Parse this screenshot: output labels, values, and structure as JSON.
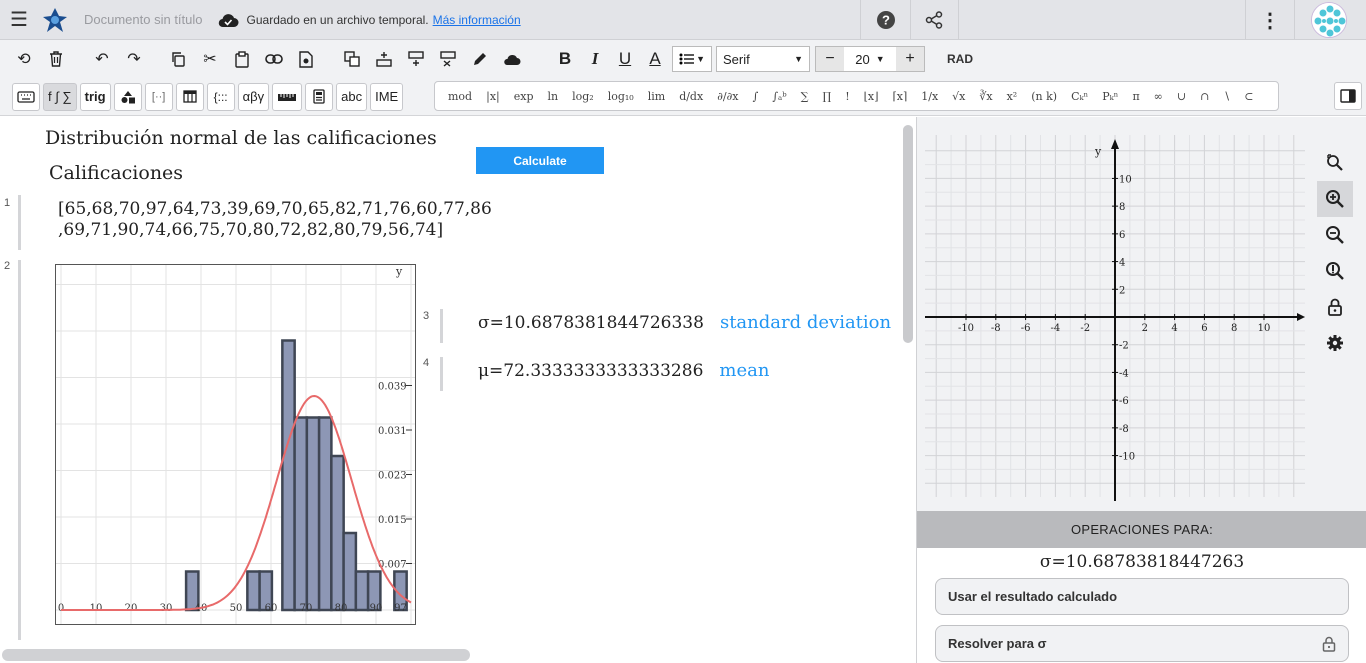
{
  "topbar": {
    "doc_title": "Documento sin título",
    "save_status": "Guardado en un archivo temporal.",
    "more_info_link": "Más información"
  },
  "toolbar": {
    "font_family": "Serif",
    "font_size": "20",
    "angle_mode": "RAD",
    "bold": "B",
    "italic": "I",
    "underline": "U",
    "color": "A",
    "minus": "−",
    "plus": "+"
  },
  "keyboard_tabs": [
    "f ∫ ∑",
    "trig",
    "αβγ",
    "abc",
    "IME"
  ],
  "symbols": [
    "mod",
    "|x|",
    "exp",
    "ln",
    "log₂",
    "log₁₀",
    "lim",
    "d/dx",
    "∂/∂x",
    "∫",
    "∫ₐᵇ",
    "∑",
    "∏",
    "!",
    "⌊x⌋",
    "⌈x⌉",
    "1/x",
    "√x",
    "∛x",
    "x²",
    "(n k)",
    "Cₖⁿ",
    "Pₖⁿ",
    "π",
    "∞",
    "∪",
    "∩",
    "∖",
    "⊂"
  ],
  "doc": {
    "heading": "Distribución normal de las calificaciones",
    "subheading": "Calificaciones",
    "calculate_button": "Calculate",
    "line_numbers": [
      "1",
      "2",
      "3",
      "4"
    ],
    "data_line1": "[65,68,70,97,64,73,39,69,70,65,82,71,76,60,77,86",
    "data_line2": ",69,71,90,74,66,75,70,80,72,82,80,79,56,74]",
    "sigma_expr": "σ=10.6878381844726338",
    "sigma_note": "standard deviation",
    "mu_expr": "μ=72.3333333333333286",
    "mu_note": "mean"
  },
  "chart_data": {
    "type": "bar",
    "x_ticks": [
      0,
      10,
      20,
      30,
      40,
      50,
      60,
      70,
      80,
      90,
      97
    ],
    "y_ticks": [
      "0.007",
      "0.015",
      "0.023",
      "0.031",
      "0.039"
    ],
    "ylabel": "y",
    "bins": [
      {
        "x": 37.5,
        "count": 1
      },
      {
        "x": 55,
        "count": 1
      },
      {
        "x": 58.5,
        "count": 1
      },
      {
        "x": 65,
        "count": 7
      },
      {
        "x": 68.5,
        "count": 5
      },
      {
        "x": 72,
        "count": 5
      },
      {
        "x": 75.5,
        "count": 5
      },
      {
        "x": 79,
        "count": 4
      },
      {
        "x": 82.5,
        "count": 2
      },
      {
        "x": 86,
        "count": 1
      },
      {
        "x": 89.5,
        "count": 1
      },
      {
        "x": 97,
        "count": 1
      }
    ],
    "xlim": [
      0,
      100
    ],
    "mean": 72.3333,
    "std": 10.6878,
    "curve_color": "#e86a6a",
    "bar_color": "#8d97b5"
  },
  "graph": {
    "x_labels": [
      "-10",
      "-8",
      "-6",
      "-4",
      "-2",
      "2",
      "4",
      "6",
      "8",
      "10"
    ],
    "y_labels": [
      "10",
      "8",
      "6",
      "4",
      "2",
      "-2",
      "-4",
      "-6",
      "-8",
      "-10"
    ],
    "y_axis": "y"
  },
  "ops": {
    "header": "OPERACIONES PARA:",
    "value": "σ=10.68783818447263",
    "use_result": "Usar el resultado calculado",
    "solve_for": "Resolver para σ"
  }
}
